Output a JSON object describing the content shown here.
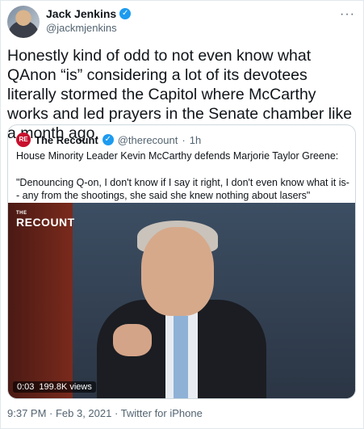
{
  "author": {
    "display_name": "Jack Jenkins",
    "handle": "@jackmjenkins",
    "verified_icon": "verified-badge-icon"
  },
  "more_label": "···",
  "tweet_text": "Honestly kind of odd to not even know what QAnon “is” considering a lot of its devotees literally stormed the Capitol where McCarthy works and led prayers in the Senate chamber like a month ago.",
  "quote": {
    "avatar_text": "RE",
    "name": "The Recount",
    "handle": "@therecount",
    "separator": "·",
    "time": "1h",
    "line1": "House Minority Leader Kevin McCarthy defends Marjorie Taylor Greene:",
    "line2": "\"Denouncing Q-on, I don't know if I say it right, I don't even know what it is-- any from the shootings, she said she knew nothing about lasers\"",
    "video": {
      "logo": "RECOUNT",
      "logo_prefix": "THE",
      "duration": "0:03",
      "views": "199.8K views"
    }
  },
  "footer": "9:37 PM · Feb 3, 2021 · Twitter for iPhone",
  "colors": {
    "accent": "#1d9bf0",
    "secondary_text": "#536471",
    "border": "#cfd9de"
  }
}
